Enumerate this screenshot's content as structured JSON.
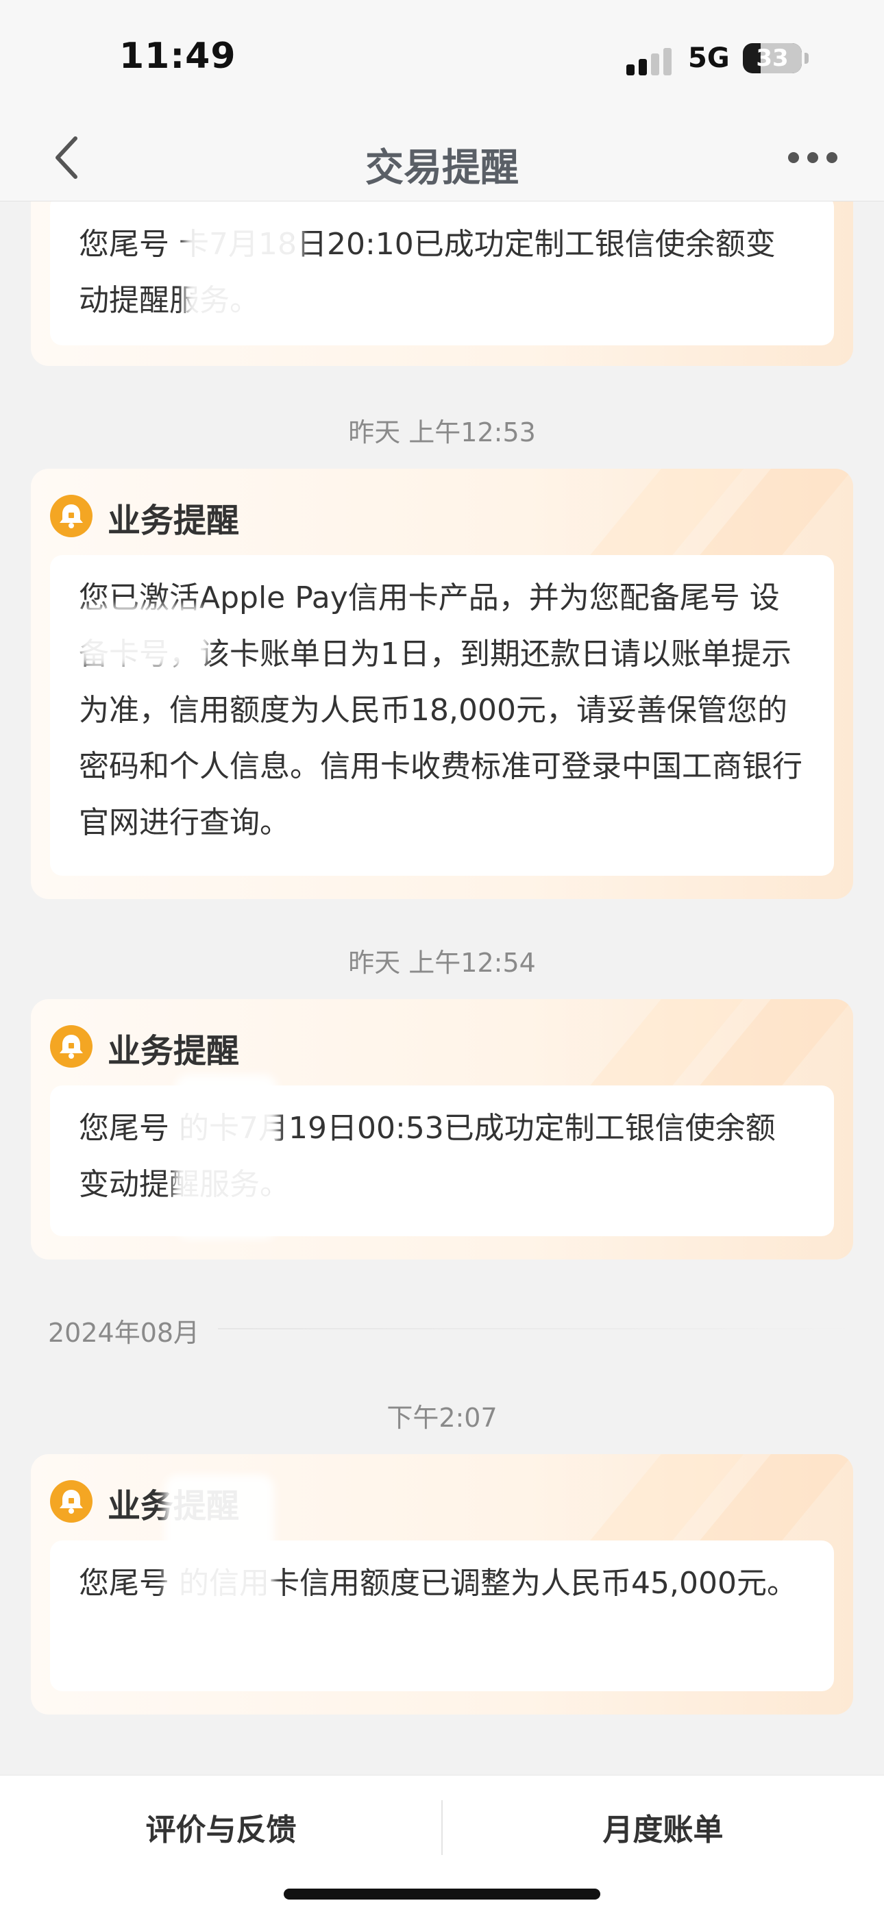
{
  "status_bar": {
    "time": "11:49",
    "network": "5G",
    "battery": "33"
  },
  "nav": {
    "title": "交易提醒"
  },
  "timeline": {
    "card0_text": "您尾号      卡7月18日20:10已成功定制工银信使余额变动提醒服务。",
    "time1": "昨天  上午12:53",
    "card1_title": "业务提醒",
    "card1_text": "您已激活Apple Pay信用卡产品，并为您配备尾号        设备卡号，该卡账单日为1日，到期还款日请以账单提示为准，信用额度为人民币18,000元，请妥善保管您的密码和个人信息。信用卡收费标准可登录中国工商银行官网进行查询。",
    "time2": "昨天  上午12:54",
    "card2_title": "业务提醒",
    "card2_text": "您尾号      的卡7月19日00:53已成功定制工银信使余额变动提醒服务。",
    "month": "2024年08月",
    "time3": "下午2:07",
    "card3_title": "业务提醒",
    "card3_text": "您尾号      的信用卡信用额度已调整为人民币45,000元。"
  },
  "bottom_bar": {
    "feedback_label": "评价与反馈",
    "monthly_bill_label": "月度账单"
  },
  "icons": {
    "back": "chevron-left-icon",
    "more": "more-dots-icon",
    "bell": "bell-icon"
  },
  "colors": {
    "accent": "#f4a623",
    "card_gradient_end": "#fde9d4"
  }
}
